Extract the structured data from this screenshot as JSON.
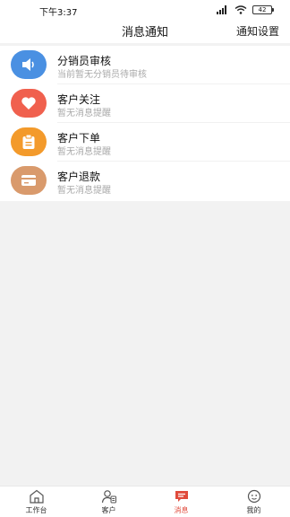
{
  "status_bar": {
    "time": "下午3:37",
    "battery": "42"
  },
  "header": {
    "title": "消息通知",
    "action": "通知设置"
  },
  "notifications": [
    {
      "icon": "speaker-icon",
      "color": "#4a90e2",
      "title": "分销员审核",
      "subtitle": "当前暂无分销员待审核"
    },
    {
      "icon": "heart-icon",
      "color": "#f0604e",
      "title": "客户关注",
      "subtitle": "暂无消息提醒"
    },
    {
      "icon": "clipboard-icon",
      "color": "#f39a2b",
      "title": "客户下单",
      "subtitle": "暂无消息提醒"
    },
    {
      "icon": "card-icon",
      "color": "#d99a6c",
      "title": "客户退款",
      "subtitle": "暂无消息提醒"
    }
  ],
  "tabbar": [
    {
      "icon": "home-icon",
      "label": "工作台",
      "active": false
    },
    {
      "icon": "customer-icon",
      "label": "客户",
      "active": false
    },
    {
      "icon": "message-icon",
      "label": "消息",
      "active": true
    },
    {
      "icon": "profile-icon",
      "label": "我的",
      "active": false
    }
  ],
  "colors": {
    "accent": "#e04b3c"
  }
}
